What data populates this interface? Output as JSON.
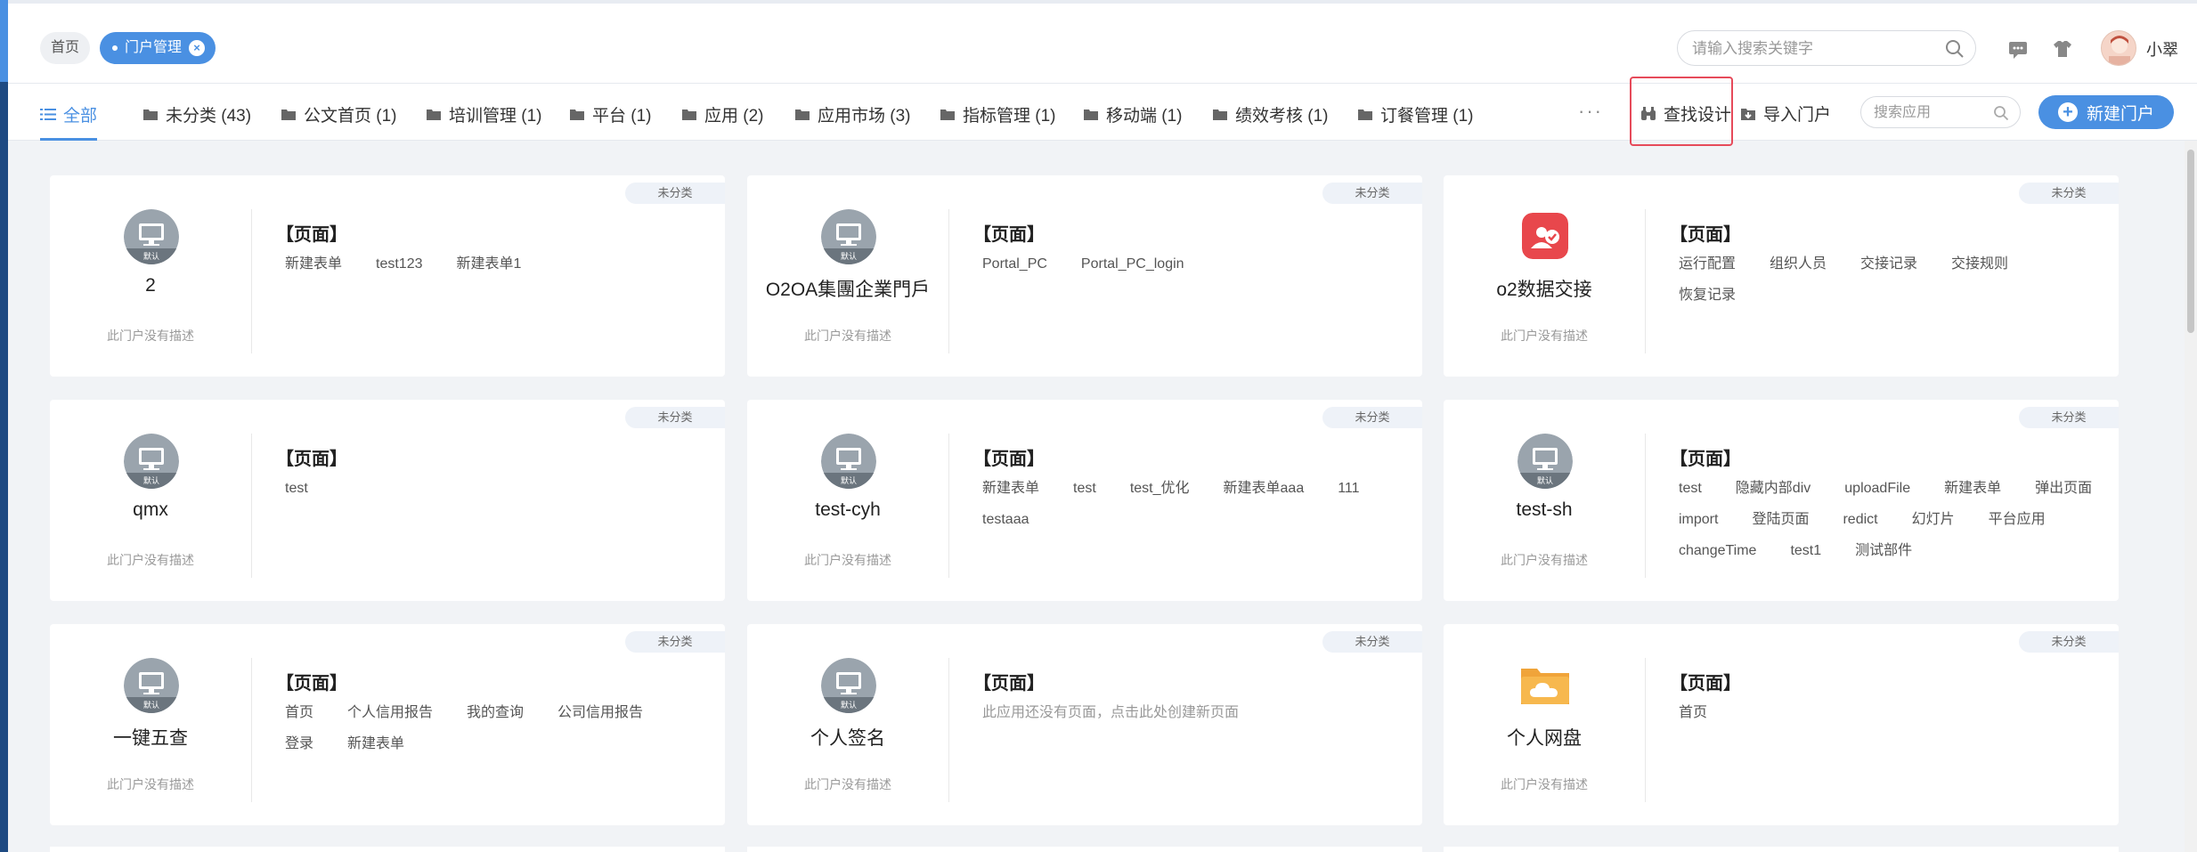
{
  "header": {
    "breadcrumb_home": "首页",
    "breadcrumb_active": "门户管理",
    "search_placeholder": "请输入搜索关键字",
    "username": "小翠",
    "accent": "#4a90e2"
  },
  "tabs": [
    {
      "label": "全部",
      "icon": "list-icon"
    },
    {
      "label": "未分类 (43)",
      "icon": "folder-icon"
    },
    {
      "label": "公文首页 (1)",
      "icon": "folder-icon"
    },
    {
      "label": "培训管理 (1)",
      "icon": "folder-icon"
    },
    {
      "label": "平台 (1)",
      "icon": "folder-icon"
    },
    {
      "label": "应用 (2)",
      "icon": "folder-icon"
    },
    {
      "label": "应用市场 (3)",
      "icon": "folder-icon"
    },
    {
      "label": "指标管理 (1)",
      "icon": "folder-icon"
    },
    {
      "label": "移动端 (1)",
      "icon": "folder-icon"
    },
    {
      "label": "绩效考核 (1)",
      "icon": "folder-icon"
    },
    {
      "label": "订餐管理 (1)",
      "icon": "folder-icon"
    }
  ],
  "toolbar": {
    "more": "···",
    "find_design": "查找设计",
    "import_portal": "导入门户",
    "app_search_placeholder": "搜索应用",
    "new_portal": "新建门户"
  },
  "cards": [
    {
      "name": "2",
      "category": "未分类",
      "icon": "default-monitor-icon",
      "icon_badge": "默认",
      "desc": "此门户没有描述",
      "pages_title": "【页面】",
      "pages": [
        "新建表单",
        "test123",
        "新建表单1"
      ]
    },
    {
      "name": "O2OA集團企業門戶",
      "category": "未分类",
      "icon": "default-monitor-icon",
      "icon_badge": "默认",
      "desc": "此门户没有描述",
      "pages_title": "【页面】",
      "pages": [
        "Portal_PC",
        "Portal_PC_login"
      ]
    },
    {
      "name": "o2数据交接",
      "category": "未分类",
      "icon": "data-exchange-icon",
      "icon_badge": "",
      "desc": "此门户没有描述",
      "pages_title": "【页面】",
      "pages": [
        "运行配置",
        "组织人员",
        "交接记录",
        "交接规则",
        "恢复记录"
      ]
    },
    {
      "name": "qmx",
      "category": "未分类",
      "icon": "default-monitor-icon",
      "icon_badge": "默认",
      "desc": "此门户没有描述",
      "pages_title": "【页面】",
      "pages": [
        "test"
      ]
    },
    {
      "name": "test-cyh",
      "category": "未分类",
      "icon": "default-monitor-icon",
      "icon_badge": "默认",
      "desc": "此门户没有描述",
      "pages_title": "【页面】",
      "pages": [
        "新建表单",
        "test",
        "test_优化",
        "新建表单aaa",
        "111",
        "testaaa"
      ]
    },
    {
      "name": "test-sh",
      "category": "未分类",
      "icon": "default-monitor-icon",
      "icon_badge": "默认",
      "desc": "此门户没有描述",
      "pages_title": "【页面】",
      "pages": [
        "test",
        "隐藏内部div",
        "uploadFile",
        "新建表单",
        "弹出页面",
        "import",
        "登陆页面",
        "redict",
        "幻灯片",
        "平台应用",
        "changeTime",
        "test1",
        "测试部件"
      ]
    },
    {
      "name": "一键五查",
      "category": "未分类",
      "icon": "default-monitor-icon",
      "icon_badge": "默认",
      "desc": "此门户没有描述",
      "pages_title": "【页面】",
      "pages": [
        "首页",
        "个人信用报告",
        "我的查询",
        "公司信用报告",
        "登录",
        "新建表单"
      ]
    },
    {
      "name": "个人签名",
      "category": "未分类",
      "icon": "default-monitor-icon",
      "icon_badge": "默认",
      "desc": "此门户没有描述",
      "pages_title": "【页面】",
      "pages": [],
      "empty_text": "此应用还没有页面，点击此处创建新页面"
    },
    {
      "name": "个人网盘",
      "category": "未分类",
      "icon": "cloud-folder-icon",
      "icon_badge": "",
      "desc": "此门户没有描述",
      "pages_title": "【页面】",
      "pages": [
        "首页"
      ]
    }
  ]
}
